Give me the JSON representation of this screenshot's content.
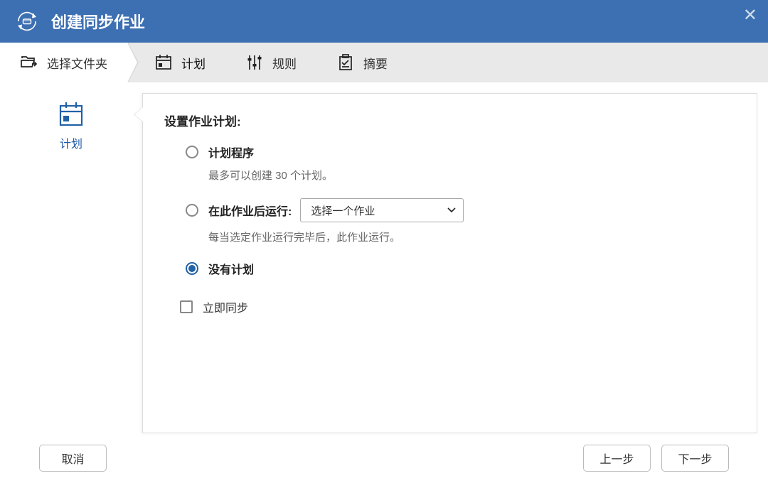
{
  "header": {
    "title": "创建同步作业"
  },
  "steps": {
    "select_folder": "选择文件夹",
    "schedule": "计划",
    "rules": "规则",
    "summary": "摘要"
  },
  "side": {
    "label": "计划"
  },
  "main": {
    "section_title": "设置作业计划:",
    "options": {
      "scheduler": {
        "label": "计划程序",
        "desc": "最多可以创建 30 个计划。"
      },
      "after_job": {
        "label": "在此作业后运行:",
        "select_placeholder": "选择一个作业",
        "desc": "每当选定作业运行完毕后，此作业运行。"
      },
      "no_schedule": {
        "label": "没有计划"
      }
    },
    "sync_now_label": "立即同步"
  },
  "footer": {
    "cancel": "取消",
    "prev": "上一步",
    "next": "下一步"
  },
  "colors": {
    "primary": "#3d70b2",
    "accent": "#2261a6",
    "steps_bg": "#e9e9e9"
  }
}
